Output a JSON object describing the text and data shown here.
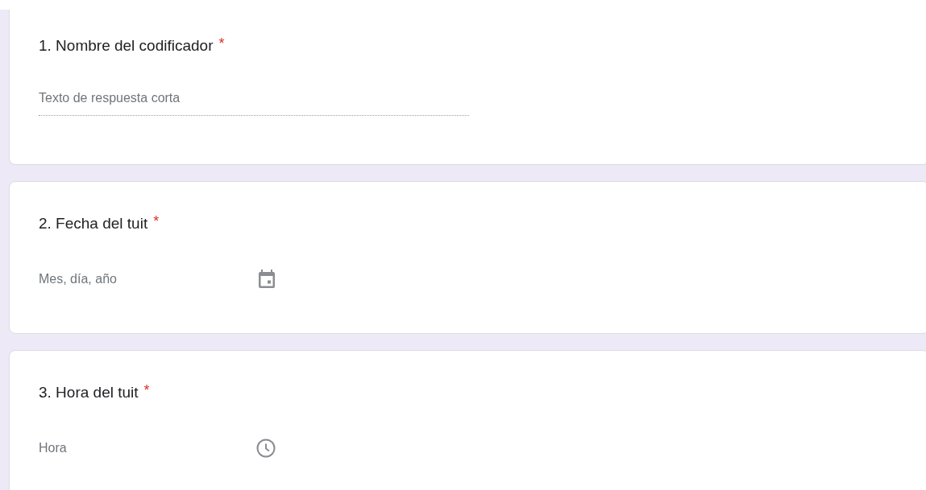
{
  "questions": [
    {
      "kind": "text",
      "title": "1. Nombre del codificador",
      "required_mark": "*",
      "placeholder": "Texto de respuesta corta"
    },
    {
      "kind": "date",
      "title": "2. Fecha del tuit",
      "required_mark": "*",
      "placeholder": "Mes, día, año"
    },
    {
      "kind": "time",
      "title": "3. Hora del tuit",
      "required_mark": "*",
      "placeholder": "Hora"
    }
  ]
}
